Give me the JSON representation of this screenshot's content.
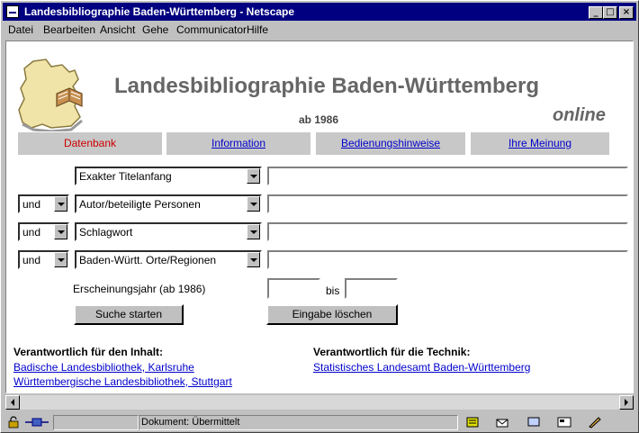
{
  "window": {
    "title": "Landesbibliographie Baden-Württemberg - Netscape"
  },
  "menu": {
    "items": [
      "Datei",
      "Bearbeiten",
      "Ansicht",
      "Gehe",
      "Communicator",
      "Hilfe"
    ]
  },
  "header": {
    "title": "Landesbibliographie Baden-Württemberg",
    "subtitle": "ab 1986",
    "online": "online"
  },
  "nav": {
    "tabs": [
      "Datenbank",
      "Information",
      "Bedienungshinweise",
      "Ihre Meinung"
    ]
  },
  "search": {
    "rows": [
      {
        "operator": "",
        "field": "Exakter Titelanfang",
        "value": ""
      },
      {
        "operator": "und",
        "field": "Autor/beteiligte Personen",
        "value": ""
      },
      {
        "operator": "und",
        "field": "Schlagwort",
        "value": ""
      },
      {
        "operator": "und",
        "field": "Baden-Württ. Orte/Regionen",
        "value": ""
      }
    ],
    "year_label": "Erscheinungsjahr (ab 1986)",
    "year_bis": "bis",
    "submit_label": "Suche starten",
    "reset_label": "Eingabe löschen"
  },
  "footer": {
    "content_heading": "Verantwortlich für den Inhalt:",
    "content_links": [
      "Badische Landesbibliothek, Karlsruhe",
      "Württembergische Landesbibliothek, Stuttgart"
    ],
    "tech_heading": "Verantwortlich für die Technik:",
    "tech_links": [
      "Statistisches Landesamt Baden-Württemberg"
    ]
  },
  "status": {
    "text": "Dokument: Übermittelt"
  },
  "colors": {
    "titlebar": "#000080",
    "link": "#0000cc",
    "active_tab": "#cc0000",
    "tab_bg": "#c8c8c8",
    "logo_map": "#f0e4a8"
  },
  "icons": [
    "window-app-icon",
    "minimize-icon",
    "maximize-icon",
    "close-icon",
    "security-lock-icon",
    "connection-icon",
    "logo-map-book-icon"
  ]
}
